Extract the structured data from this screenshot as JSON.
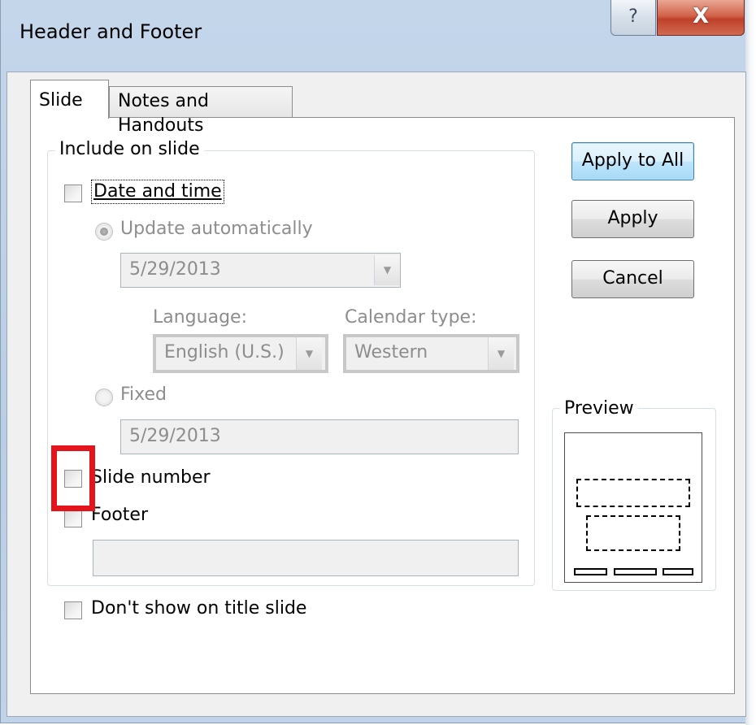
{
  "dialog": {
    "title": "Header and Footer",
    "help_glyph": "?",
    "close_glyph": "X"
  },
  "tabs": [
    {
      "label": "Slide",
      "selected": true
    },
    {
      "label": "Notes and Handouts",
      "selected": false
    }
  ],
  "include_group": {
    "label": "Include on slide",
    "date_time": {
      "label": "Date and time",
      "checked": false
    },
    "update_auto": {
      "label": "Update automatically",
      "selected": true
    },
    "auto_date_value": "5/29/2013",
    "language_label": "Language:",
    "language_value": "English (U.S.)",
    "calendar_label": "Calendar type:",
    "calendar_value": "Western",
    "fixed": {
      "label": "Fixed",
      "selected": false
    },
    "fixed_value": "5/29/2013",
    "slide_number": {
      "label": "Slide number",
      "checked": false
    },
    "footer": {
      "label": "Footer",
      "checked": false
    },
    "footer_value": ""
  },
  "dont_show_title": {
    "label": "Don't show on title slide",
    "checked": false
  },
  "buttons": {
    "apply_all": "Apply to All",
    "apply": "Apply",
    "cancel": "Cancel"
  },
  "preview": {
    "label": "Preview"
  },
  "colors": {
    "highlight": "#e4141d",
    "close_button": "#c0402a"
  }
}
